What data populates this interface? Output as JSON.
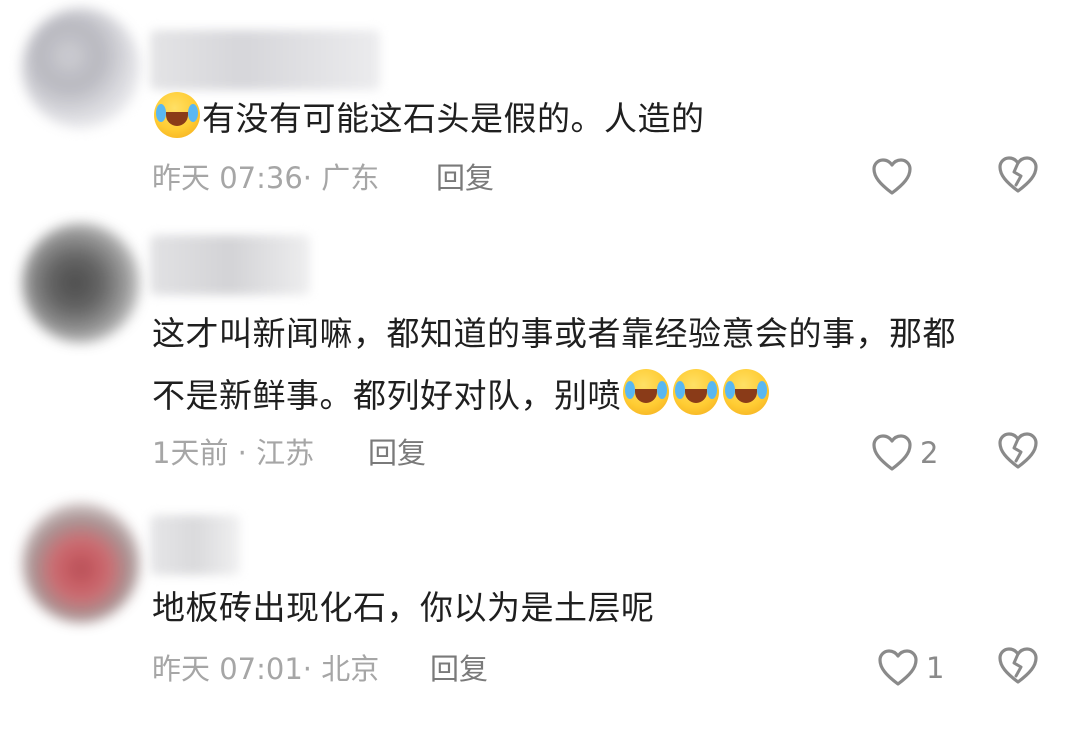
{
  "comments": [
    {
      "text_parts": [
        "",
        "有没有可能这石头是假的。人造的"
      ],
      "time": "昨天 07:36· 广东",
      "reply_label": "回复",
      "like_count": "",
      "emoji": "face-with-tears-of-joy"
    },
    {
      "line1": "这才叫新闻嘛，都知道的事或者靠经验意会的事，那都",
      "line2": "不是新鲜事。都列好对队，别喷",
      "time": "1天前 · 江苏",
      "reply_label": "回复",
      "like_count": "2",
      "emoji": "face-with-tears-of-joy"
    },
    {
      "text": "地板砖出现化石，你以为是土层呢",
      "time": "昨天 07:01· 北京",
      "reply_label": "回复",
      "like_count": "1"
    }
  ],
  "icons": {
    "like": "heart-outline-icon",
    "dislike": "broken-heart-icon"
  },
  "colors": {
    "text": "#1f1f1f",
    "meta": "#a6a6a6",
    "icon_stroke": "#8a8a8a"
  }
}
